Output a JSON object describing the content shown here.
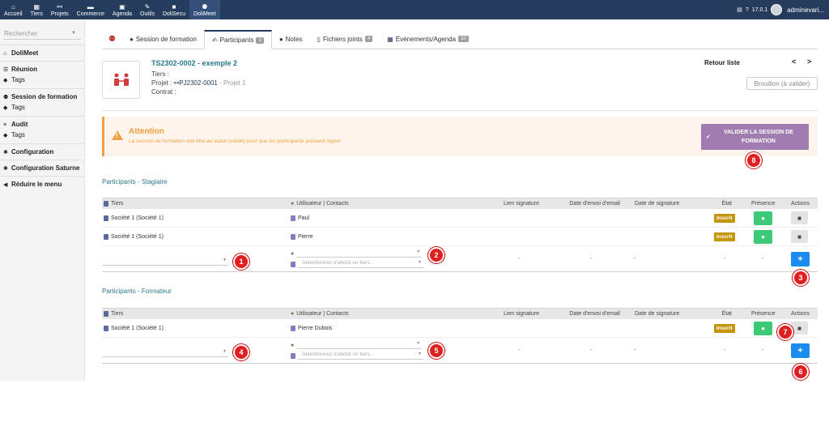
{
  "topnav": {
    "items": [
      {
        "label": "Accueil",
        "icon": "home-icon"
      },
      {
        "label": "Tiers",
        "icon": "building-icon"
      },
      {
        "label": "Projets",
        "icon": "project-icon"
      },
      {
        "label": "Commerce",
        "icon": "briefcase-icon"
      },
      {
        "label": "Agenda",
        "icon": "calendar-icon"
      },
      {
        "label": "Outils",
        "icon": "wrench-icon"
      },
      {
        "label": "DoliSecu",
        "icon": "lock-icon"
      },
      {
        "label": "DoliMeet",
        "icon": "people-icon"
      }
    ],
    "version": "17.0.1",
    "user": "adminevari..."
  },
  "sidebar": {
    "search_placeholder": "Rechercher",
    "items": [
      {
        "label": "DoliMeet",
        "sub": null
      },
      {
        "label": "Réunion",
        "sub": "Tags"
      },
      {
        "label": "Session de formation",
        "sub": "Tags"
      },
      {
        "label": "Audit",
        "sub": "Tags"
      },
      {
        "label": "Configuration",
        "sub": null
      },
      {
        "label": "Configuration Saturne",
        "sub": null
      },
      {
        "label": "Réduire le menu",
        "sub": null
      }
    ]
  },
  "tabs": [
    {
      "label": "Session de formation",
      "badge": null
    },
    {
      "label": "Participants",
      "badge": "3"
    },
    {
      "label": "Notes",
      "badge": null
    },
    {
      "label": "Fichiers joints",
      "badge": "4"
    },
    {
      "label": "Événements/Agenda",
      "badge": "10"
    }
  ],
  "record": {
    "ref": "TS2302-0002 - exemple 2",
    "tiers_label": "Tiers :",
    "projet_label": "Projet :",
    "projet_ref": "PJ2302-0001",
    "projet_name": "- Projet 1",
    "contrat_label": "Contrat :",
    "retour": "Retour liste",
    "prev": "<",
    "next": ">",
    "status": "Brouillon (à valider)"
  },
  "alert": {
    "title": "Attention",
    "text": "La session de formation doit être au statut (validé) pour que les participants puissent signer",
    "button": "VALIDER LA SESSION DE FORMATION"
  },
  "columns": [
    "Tiers",
    "Utilisateur | Contacts",
    "Lien signature",
    "Date d'envoi d'email",
    "Date de signature",
    "État",
    "Présence",
    "Actions"
  ],
  "stagiaire": {
    "title": "Participants - Stagiaire",
    "rows": [
      {
        "tiers": "Société 1 (Société 1)",
        "contact": "Paul",
        "status": "Inscrit"
      },
      {
        "tiers": "Société 1 (Société 1)",
        "contact": "Pierre",
        "status": "Inscrit"
      }
    ],
    "contact_placeholder": "Sélectionnez d'abord un tiers..."
  },
  "formateur": {
    "title": "Participants - Formateur",
    "rows": [
      {
        "tiers": "Société 1 (Société 1)",
        "contact": "Pierre Dubois",
        "status": "Inscrit"
      }
    ],
    "contact_placeholder": "Sélectionnez d'abord un tiers..."
  },
  "dash": "-",
  "markers": [
    "1",
    "2",
    "3",
    "4",
    "5",
    "6",
    "7",
    "8"
  ]
}
